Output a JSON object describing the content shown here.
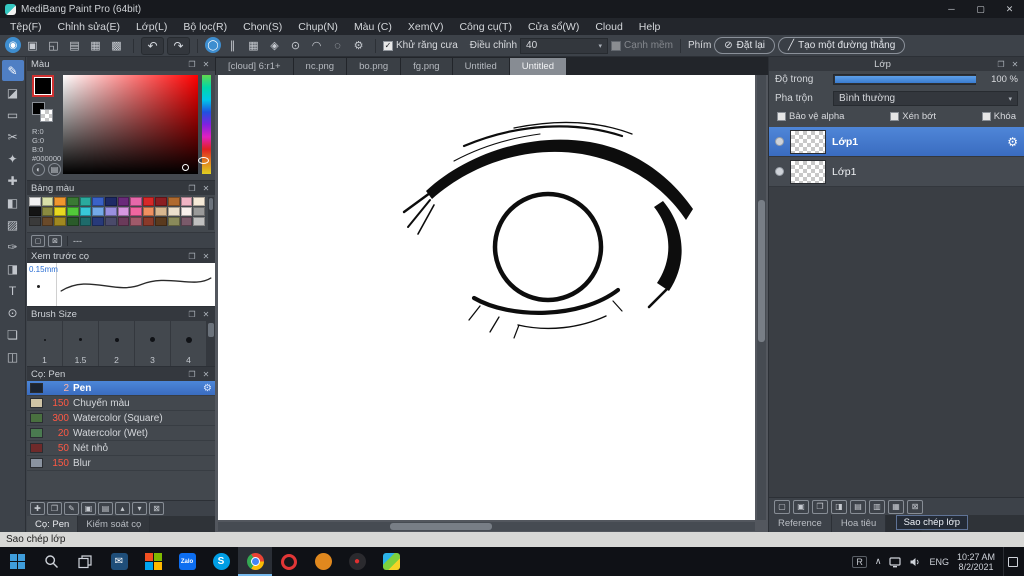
{
  "window": {
    "title": "MediBang Paint Pro (64bit)",
    "minimize": "─",
    "maximize": "▢",
    "close": "✕"
  },
  "icons": {
    "panel_float": "❐",
    "panel_close": "✕",
    "dropdown_arrow": "▾",
    "gear": "⚙",
    "check": "✓",
    "caret": "∧",
    "reset": "⊘",
    "slash": "╱",
    "undo": "↶",
    "redo": "↷"
  },
  "theme": {
    "accent_blue": "#4a80d0",
    "selection_blue": "#3a6cc0",
    "panel_bg": "#43484e",
    "taskbar_bg": "#0f1116",
    "status_bg": "#d8d8d6",
    "canvas_bg": "#ffffff",
    "ink": "#0d0d0d"
  },
  "menu": {
    "items": [
      "Tệp(F)",
      "Chỉnh sửa(E)",
      "Lớp(L)",
      "Bộ lọc(R)",
      "Chọn(S)",
      "Chụp(N)",
      "Màu (C)",
      "Xem(V)",
      "Công cụ(T)",
      "Cửa sổ(W)",
      "Cloud",
      "Help"
    ]
  },
  "toolbar": {
    "left_icons": [
      {
        "name": "color-wheel-icon",
        "glyph": "◉",
        "accent": true
      },
      {
        "name": "clipboard-icon",
        "glyph": "▣"
      },
      {
        "name": "comment-icon",
        "glyph": "◱"
      },
      {
        "name": "notes-icon",
        "glyph": "▤"
      },
      {
        "name": "grid-icon",
        "glyph": "▦"
      },
      {
        "name": "material-icon",
        "glyph": "▩"
      }
    ],
    "snap_icons": [
      {
        "name": "snap-off-icon",
        "glyph": "◯",
        "accent": true
      },
      {
        "name": "snap-parallel-icon",
        "glyph": "∥"
      },
      {
        "name": "snap-grid-icon",
        "glyph": "▦"
      },
      {
        "name": "snap-cross-icon",
        "glyph": "◈"
      },
      {
        "name": "snap-vanishing-icon",
        "glyph": "⊙"
      },
      {
        "name": "snap-radial-icon",
        "glyph": "◠"
      },
      {
        "name": "snap-ellipse-icon",
        "glyph": "◌"
      },
      {
        "name": "snap-settings-icon",
        "glyph": "⚙"
      }
    ],
    "antialias_label": "Khử răng cưa",
    "antialias_checked": true,
    "adjust_label": "Điều chỉnh",
    "adjust_value": "40",
    "soft_edge_label": "Cạnh mềm",
    "soft_edge_checked": false,
    "key_label": "Phím",
    "reset_label": "Đặt lại",
    "straight_line_label": "Tạo một đường thẳng"
  },
  "tools": {
    "items": [
      {
        "name": "brush-tool",
        "glyph": "✎",
        "selected": true
      },
      {
        "name": "eraser-tool",
        "glyph": "◪"
      },
      {
        "name": "rect-select-tool",
        "glyph": "▭"
      },
      {
        "name": "lasso-select-tool",
        "glyph": "✂"
      },
      {
        "name": "magic-wand-tool",
        "glyph": "✦"
      },
      {
        "name": "move-tool",
        "glyph": "✚"
      },
      {
        "name": "fill-tool",
        "glyph": "◧"
      },
      {
        "name": "gradient-tool",
        "glyph": "▨"
      },
      {
        "name": "select-pen-tool",
        "glyph": "✑"
      },
      {
        "name": "select-eraser-tool",
        "glyph": "◨"
      },
      {
        "name": "text-tool",
        "glyph": "T"
      },
      {
        "name": "eyedropper-tool",
        "glyph": "⊙"
      },
      {
        "name": "hand-tool",
        "glyph": "❏"
      },
      {
        "name": "divide-tool",
        "glyph": "◫"
      }
    ]
  },
  "color_panel": {
    "title": "Màu",
    "labels": [
      "R:0",
      "G:0",
      "B:0",
      "#000000"
    ],
    "current_color": "#000000"
  },
  "palette_panel": {
    "title": "Bảng màu",
    "selected_name": "---",
    "colors": [
      "#f2f2f2",
      "#d8e0a8",
      "#f0962e",
      "#3a7a34",
      "#2aaa9e",
      "#3a62c8",
      "#1e2a66",
      "#6a2a7a",
      "#e668aa",
      "#d82828",
      "#8c1e22",
      "#b06a2e",
      "#f0b4c4",
      "#f6ead8",
      "#141414",
      "#8a8a40",
      "#e8d820",
      "#52c83a",
      "#38c8d8",
      "#74aae8",
      "#9a90e0",
      "#d898e0",
      "#f066a0",
      "#f09060",
      "#d8b890",
      "#ece0cc",
      "#f8f0ec",
      "#9a9a9a",
      "#3a3a3a",
      "#6a4a2a",
      "#a08820",
      "#2a5a2a",
      "#1e6a6a",
      "#283a7a",
      "#4a4a6a",
      "#6a3a5a",
      "#a05a6a",
      "#8a3a2a",
      "#5a3a1e",
      "#8a8a5a",
      "#7a5a6a",
      "#c0c0c0"
    ]
  },
  "preview_panel": {
    "title": "Xem trước cọ",
    "size_label": "0.15mm"
  },
  "brush_size_panel": {
    "title": "Brush Size",
    "sizes": [
      "1",
      "1.5",
      "2",
      "3",
      "4"
    ]
  },
  "brush_panel": {
    "title": "Cọ: Pen",
    "items": [
      {
        "size": "2",
        "name": "Pen",
        "swatch": "#1c2430",
        "selected": true
      },
      {
        "size": "150",
        "name": "Chuyển màu",
        "swatch": "#cfc4a6"
      },
      {
        "size": "300",
        "name": "Watercolor (Square)",
        "swatch": "#49703f"
      },
      {
        "size": "20",
        "name": "Watercolor (Wet)",
        "swatch": "#4a7a50"
      },
      {
        "size": "50",
        "name": "Nét nhỏ",
        "swatch": "#6e2a2a"
      },
      {
        "size": "150",
        "name": "Blur",
        "swatch": "#8a93a0"
      }
    ],
    "buttons": [
      {
        "name": "new-brush-button",
        "glyph": "✚"
      },
      {
        "name": "duplicate-brush-button",
        "glyph": "❐"
      },
      {
        "name": "edit-brush-button",
        "glyph": "✎"
      },
      {
        "name": "save-brush-button",
        "glyph": "▣"
      },
      {
        "name": "brush-folder-button",
        "glyph": "▤"
      },
      {
        "name": "brush-move-up-button",
        "glyph": "▴"
      },
      {
        "name": "brush-move-down-button",
        "glyph": "▾"
      },
      {
        "name": "delete-brush-button",
        "glyph": "⊠"
      }
    ],
    "footer_tabs": [
      {
        "label": "Cọ: Pen",
        "active": true
      },
      {
        "label": "Kiểm soát cọ",
        "active": false
      }
    ]
  },
  "canvas": {
    "tabs": [
      {
        "label": "[cloud] 6:r1+",
        "active": false
      },
      {
        "label": "nc.png",
        "active": false
      },
      {
        "label": "bo.png",
        "active": false
      },
      {
        "label": "fg.png",
        "active": false
      },
      {
        "label": "Untitled",
        "active": false
      },
      {
        "label": "Untitled",
        "active": true
      }
    ]
  },
  "layer_panel": {
    "title": "Lớp",
    "opacity_label": "Độ trong",
    "opacity_value": "100 %",
    "blend_label": "Pha trộn",
    "blend_value": "Bình thường",
    "checkboxes": [
      {
        "label": "Bảo vệ alpha",
        "checked": false
      },
      {
        "label": "Xén bớt",
        "checked": false
      },
      {
        "label": "Khóa",
        "checked": false
      }
    ],
    "layers": [
      {
        "name": "Lớp1",
        "selected": true
      },
      {
        "name": "Lớp1",
        "selected": false
      }
    ],
    "buttons": [
      {
        "name": "new-layer-button",
        "glyph": "▢"
      },
      {
        "name": "new-layer-option-button",
        "glyph": "▣"
      },
      {
        "name": "duplicate-layer-button",
        "glyph": "❐"
      },
      {
        "name": "transfer-layer-button",
        "glyph": "◨"
      },
      {
        "name": "new-folder-button",
        "glyph": "▤"
      },
      {
        "name": "merge-layer-button",
        "glyph": "▥"
      },
      {
        "name": "apply-layer-button",
        "glyph": "▦"
      },
      {
        "name": "delete-layer-button",
        "glyph": "⊠"
      }
    ],
    "footer_tabs": [
      {
        "label": "Reference",
        "active": false
      },
      {
        "label": "Hoa tiêu",
        "active": false
      },
      {
        "label": "Lớp",
        "active": true
      }
    ],
    "tooltip": "Sao chép lớp"
  },
  "status_bar": {
    "text": "Sao chép lớp"
  },
  "taskbar": {
    "apps": [
      {
        "name": "start-button",
        "kind": "start"
      },
      {
        "name": "search-button",
        "kind": "search"
      },
      {
        "name": "task-view-button",
        "kind": "taskview"
      },
      {
        "name": "mail-app-icon",
        "bg": "#1f4e79",
        "glyph": "✉"
      },
      {
        "name": "store-app-icon",
        "kind": "msgrid"
      },
      {
        "name": "zalo-app-icon",
        "bg": "#0d6ef0",
        "glyph": "Zalo",
        "small": true
      },
      {
        "name": "skype-app-icon",
        "bg": "#009ee5",
        "glyph": "S",
        "round": true
      },
      {
        "name": "chrome-app-icon",
        "kind": "chrome",
        "active": true
      },
      {
        "name": "opera-app-icon",
        "kind": "opera"
      },
      {
        "name": "firefox-app-icon",
        "bg": "#e0881e",
        "glyph": "",
        "round": true
      },
      {
        "name": "recorder-app-icon",
        "bg": "#2a2a2e",
        "glyph": "●",
        "fg": "#e03030",
        "round": true
      },
      {
        "name": "paint-app-icon",
        "kind": "paint"
      }
    ],
    "tray": {
      "ime": "R",
      "lang": "ENG",
      "time": "10:27 AM",
      "date": "8/2/2021"
    }
  }
}
